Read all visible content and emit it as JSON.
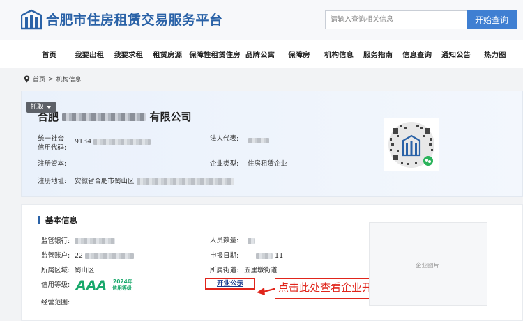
{
  "header": {
    "site_title": "合肥市住房租赁交易服务平台",
    "search_placeholder": "请输入查询相关信息",
    "search_button": "开始查询"
  },
  "nav": [
    "首页",
    "我要出租",
    "我要求租",
    "租赁房源",
    "保障性租赁住房",
    "品牌公寓",
    "保障房",
    "机构信息",
    "服务指南",
    "信息查询",
    "通知公告",
    "热力图"
  ],
  "breadcrumb": {
    "home": "首页",
    "separator": ">",
    "current": "机构信息"
  },
  "company": {
    "grab_label": "抓取",
    "name_prefix": "合肥",
    "name_suffix": "有限公司",
    "credit_code_label_1": "统一社会",
    "credit_code_label_2": "信用代码:",
    "credit_code_prefix": "9134",
    "legal_rep_label": "法人代表:",
    "capital_label": "注册资本:",
    "type_label": "企业类型:",
    "type_value": "住房租赁企业",
    "address_label": "注册地址:",
    "address_prefix": "安徽省合肥市蜀山区"
  },
  "basic": {
    "title": "基本信息",
    "bank_label": "监管银行:",
    "account_label": "监管账户:",
    "account_prefix": "22",
    "district_label": "所属区域:",
    "district_value": "蜀山区",
    "credit_label": "信用等级:",
    "credit_rating": "AAA",
    "credit_year": "2024年",
    "credit_year_sub": "信用等级",
    "scope_label": "经营范围:",
    "staff_label": "人员数量:",
    "report_label": "申报日期:",
    "report_suffix": "11",
    "street_label": "所属街道:",
    "street_value": "五里墩街道",
    "open_notice": "开业公示",
    "company_image": "企业图片"
  },
  "annotation": {
    "callout": "点击此处查看企业开业公示"
  },
  "colors": {
    "brand": "#2a62a7",
    "button": "#3f7fd2",
    "annotation": "#e0251b",
    "rating": "#19a86b"
  }
}
